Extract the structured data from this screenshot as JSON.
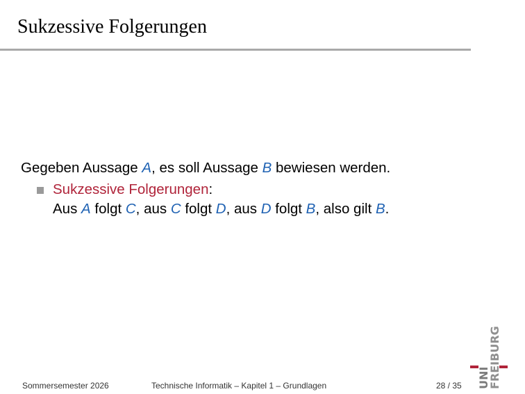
{
  "slide": {
    "title": "Sukzessive Folgerungen"
  },
  "body": {
    "intro": {
      "part1": "Gegeben Aussage ",
      "var1": "A",
      "part2": ", es soll Aussage ",
      "var2": "B",
      "part3": " bewiesen werden."
    },
    "item": {
      "term": "Sukzessive Folgerungen",
      "colon": ":",
      "line2": {
        "t1": "Aus ",
        "v1": "A",
        "t2": " folgt ",
        "v2": "C",
        "t3": ", aus ",
        "v3": "C",
        "t4": " folgt ",
        "v4": "D",
        "t5": ", aus ",
        "v5": "D",
        "t6": " folgt ",
        "v6": "B",
        "t7": ", also gilt ",
        "v7": "B",
        "t8": "."
      }
    }
  },
  "footer": {
    "semester": "Sommersemester 2026",
    "course": "Technische Informatik – Kapitel 1 – Grundlagen",
    "page": "28 / 35"
  },
  "logo": {
    "uni": "UNI",
    "freiburg": "FREIBURG"
  },
  "colors": {
    "variable": "#1f62b3",
    "term": "#b0243a",
    "rule": "#a9a9a9"
  }
}
